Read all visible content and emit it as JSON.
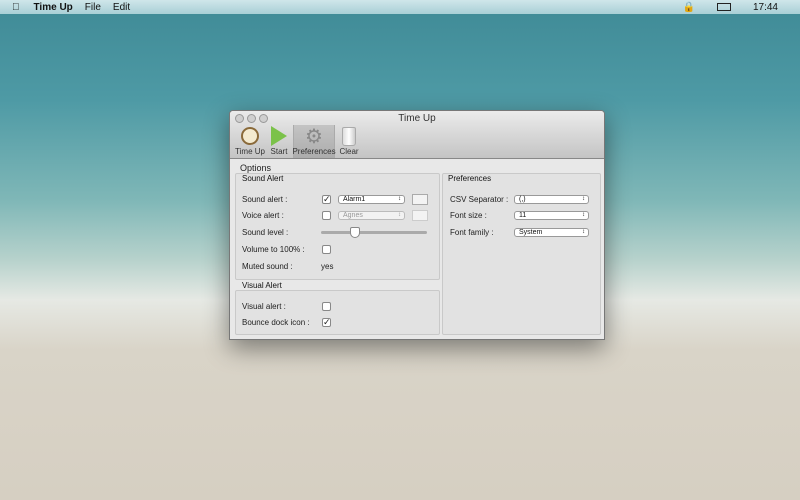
{
  "menubar": {
    "app": "Time Up",
    "items": [
      "File",
      "Edit"
    ],
    "clock": "17:44"
  },
  "window": {
    "title": "Time Up",
    "toolbar": [
      {
        "label": "Time Up",
        "icon": "clock-icon"
      },
      {
        "label": "Start",
        "icon": "play-icon"
      },
      {
        "label": "Preferences",
        "icon": "gear-icon"
      },
      {
        "label": "Clear",
        "icon": "trash-icon"
      }
    ],
    "options_title": "Options",
    "sound": {
      "title": "Sound Alert",
      "sound_alert": "Sound alert :",
      "sound_alert_value": "Alarm1",
      "voice_alert": "Voice alert :",
      "voice_value": "Agnes",
      "sound_level": "Sound level :",
      "sound_level_fraction": 0.3,
      "volume": "Volume to 100% :",
      "muted": "Muted sound :",
      "muted_value": "yes"
    },
    "visual": {
      "title": "Visual Alert",
      "visual_alert": "Visual alert :",
      "bounce": "Bounce dock icon :"
    },
    "prefs": {
      "title": "Preferences",
      "csv": "CSV Separator :",
      "csv_value": "(,)",
      "font_size": "Font size :",
      "font_size_value": "11",
      "font_family": "Font family :",
      "font_family_value": "System"
    }
  }
}
